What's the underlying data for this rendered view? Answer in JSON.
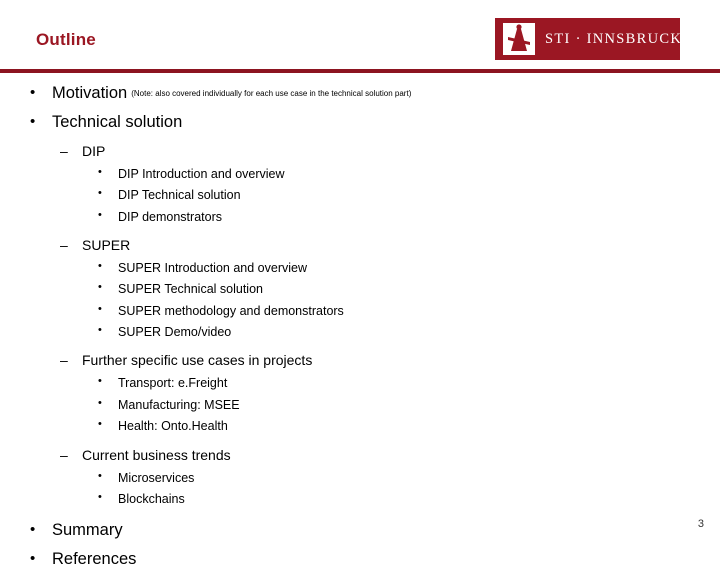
{
  "slide": {
    "title": "Outline",
    "page_number": "3",
    "accent_color": "#9b1723",
    "divider_color": "#8c1420"
  },
  "logo": {
    "mark_name": "sti-innsbruck-logo-mark",
    "text": "STI · INNSBRUCK"
  },
  "outline": {
    "items": [
      {
        "label": "Motivation",
        "note": "(Note: also covered individually for each use case in the technical solution part)"
      },
      {
        "label": "Technical solution",
        "sub": [
          {
            "label": "DIP",
            "sub": [
              "DIP Introduction and overview",
              "DIP Technical solution",
              "DIP demonstrators"
            ]
          },
          {
            "label": "SUPER",
            "sub": [
              "SUPER Introduction and overview",
              "SUPER Technical solution",
              "SUPER methodology and demonstrators",
              "SUPER Demo/video"
            ]
          },
          {
            "label": "Further specific use cases in projects",
            "sub": [
              "Transport: e.Freight",
              "Manufacturing: MSEE",
              "Health: Onto.Health"
            ]
          },
          {
            "label": "Current business trends",
            "sub": [
              "Microservices",
              "Blockchains"
            ]
          }
        ]
      },
      {
        "label": "Summary"
      },
      {
        "label": "References"
      }
    ]
  },
  "bullets": {
    "level1": "•",
    "level2": "–",
    "level3": "•"
  }
}
